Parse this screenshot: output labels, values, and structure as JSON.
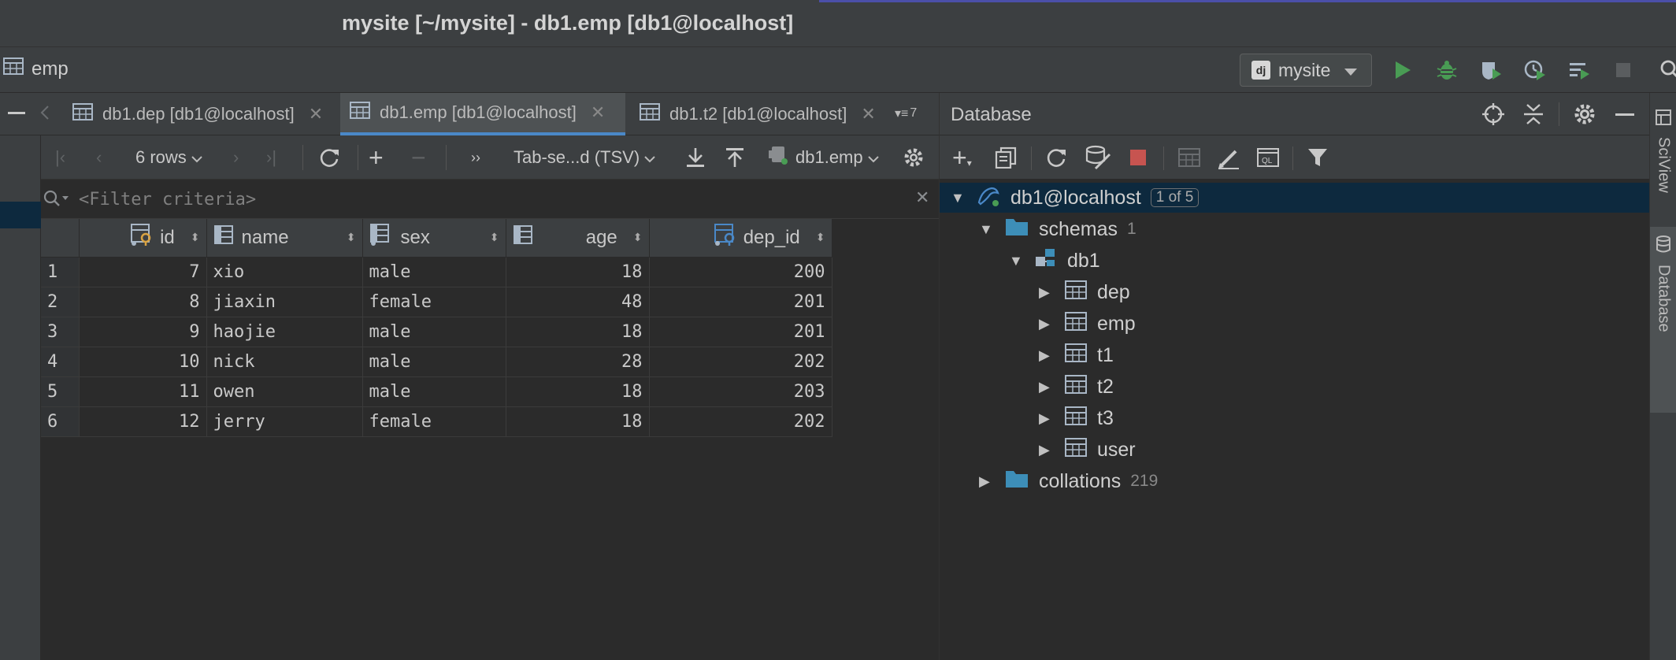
{
  "window": {
    "title": "mysite [~/mysite] - db1.emp [db1@localhost]"
  },
  "nav": {
    "breadcrumb": "emp",
    "run_config": "mysite",
    "run_config_badge": "dj"
  },
  "tabs": [
    {
      "label": "db1.dep [db1@localhost]"
    },
    {
      "label": "db1.emp [db1@localhost]"
    },
    {
      "label": "db1.t2 [db1@localhost]"
    }
  ],
  "tabs_overflow": "7",
  "grid_toolbar": {
    "rows_label": "6 rows",
    "format_label": "Tab-se...d (TSV)",
    "table_label": "db1.emp"
  },
  "filter": {
    "placeholder": "<Filter criteria>"
  },
  "grid": {
    "columns": [
      "id",
      "name",
      "sex",
      "age",
      "dep_id"
    ],
    "rows": [
      {
        "n": "1",
        "id": "7",
        "name": "xio",
        "sex": "male",
        "age": "18",
        "dep_id": "200"
      },
      {
        "n": "2",
        "id": "8",
        "name": "jiaxin",
        "sex": "female",
        "age": "48",
        "dep_id": "201"
      },
      {
        "n": "3",
        "id": "9",
        "name": "haojie",
        "sex": "male",
        "age": "18",
        "dep_id": "201"
      },
      {
        "n": "4",
        "id": "10",
        "name": "nick",
        "sex": "male",
        "age": "28",
        "dep_id": "202"
      },
      {
        "n": "5",
        "id": "11",
        "name": "owen",
        "sex": "male",
        "age": "18",
        "dep_id": "203"
      },
      {
        "n": "6",
        "id": "12",
        "name": "jerry",
        "sex": "female",
        "age": "18",
        "dep_id": "202"
      }
    ]
  },
  "db_panel": {
    "title": "Database",
    "root": {
      "label": "db1@localhost",
      "badge": "1 of 5"
    },
    "schemas": {
      "label": "schemas",
      "count": "1"
    },
    "schema": "db1",
    "tables": [
      "dep",
      "emp",
      "t1",
      "t2",
      "t3",
      "user"
    ],
    "collations": {
      "label": "collations",
      "count": "219"
    }
  },
  "right_strip": {
    "sciview": "SciView",
    "database": "Database"
  },
  "colors": {
    "run_green": "#499c54",
    "stop_red": "#c75450",
    "selection": "#0d293e",
    "accent_blue": "#4a88c7",
    "key_yellow": "#d9a343"
  }
}
